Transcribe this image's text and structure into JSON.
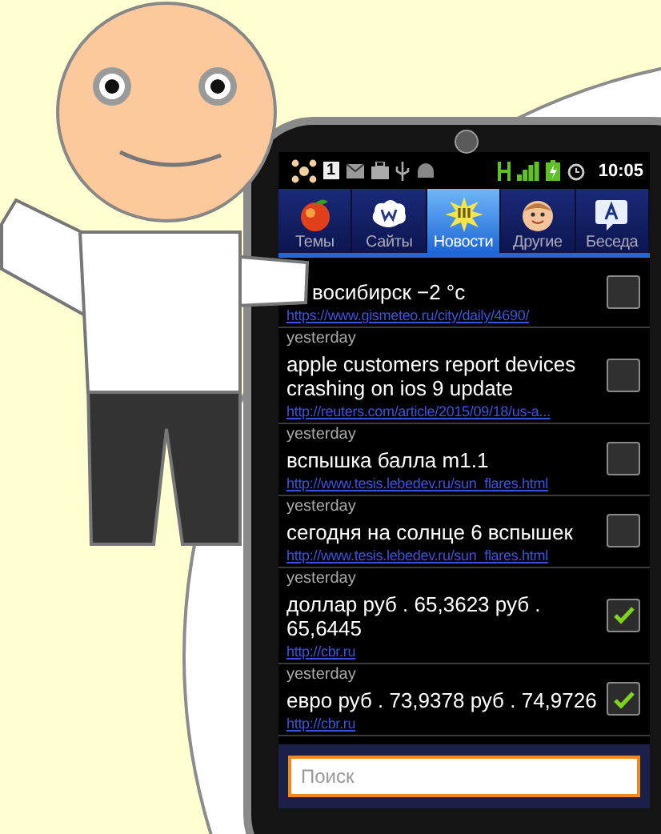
{
  "status_bar": {
    "notification_count": "1",
    "time": "10:05"
  },
  "tabs": [
    {
      "label": "Темы",
      "selected": false
    },
    {
      "label": "Сайты",
      "selected": false
    },
    {
      "label": "Новости",
      "selected": true
    },
    {
      "label": "Другие",
      "selected": false
    },
    {
      "label": "Беседа",
      "selected": false
    }
  ],
  "items": [
    {
      "title": "восибирск −2 °c",
      "link": "https://www.gismeteo.ru/city/daily/4690/",
      "checked": false
    },
    {
      "date": "yesterday",
      "title": "apple customers report devices crashing on ios 9 update",
      "link": "http://reuters.com/article/2015/09/18/us-a...",
      "checked": false
    },
    {
      "date": "yesterday",
      "title": "вспышка балла m1.1",
      "link": "http://www.tesis.lebedev.ru/sun_flares.html",
      "checked": false
    },
    {
      "date": "yesterday",
      "title": "сегодня на солнце 6 вспышек",
      "link": "http://www.tesis.lebedev.ru/sun_flares.html",
      "checked": false
    },
    {
      "date": "yesterday",
      "title": "доллар руб . 65,3623 руб . 65,6445",
      "link": "http://cbr.ru",
      "checked": true
    },
    {
      "date": "yesterday",
      "title": "евро руб . 73,9378 руб . 74,9726",
      "link": "http://cbr.ru",
      "checked": true
    }
  ],
  "search": {
    "placeholder": "Поиск"
  }
}
